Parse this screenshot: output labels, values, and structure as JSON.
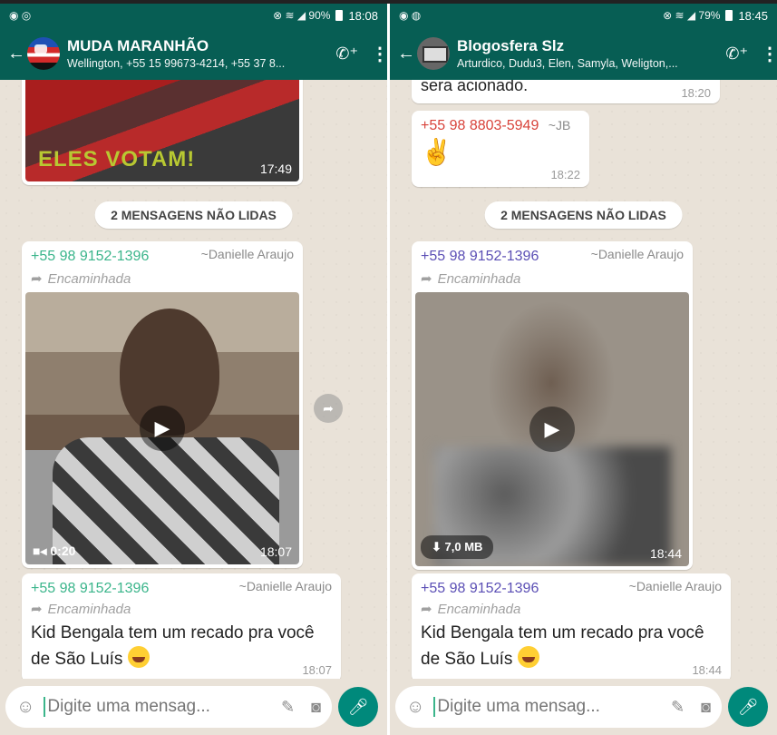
{
  "left": {
    "status": {
      "left_icons": "◉ ◎",
      "right_text": "⊗ ≋ ◢ 90%",
      "time": "18:08"
    },
    "header": {
      "title": "MUDA MARANHÃO",
      "subtitle": "Wellington, +55 15 99673-4214, +55 37 8..."
    },
    "top_image": {
      "overlay_text": "ELES VOTAM!",
      "time": "17:49"
    },
    "unread_banner": "2 MENSAGENS NÃO LIDAS",
    "video_msg": {
      "sender": "+55 98 9152-1396",
      "nick": "~Danielle Araujo",
      "forwarded": "Encaminhada",
      "duration": "0:20",
      "time": "18:07"
    },
    "text_msg": {
      "sender": "+55 98 9152-1396",
      "nick": "~Danielle Araujo",
      "forwarded": "Encaminhada",
      "text": "Kid Bengala tem um recado pra você de São Luís",
      "time": "18:07"
    },
    "input_placeholder": "Digite uma mensag..."
  },
  "right": {
    "status": {
      "left_icons": "◉ ◍",
      "right_text": "⊗ ≋ ◢ 79%",
      "time": "18:45"
    },
    "header": {
      "title": "Blogosfera Slz",
      "subtitle": "Arturdico, Dudu3, Elen, Samyla, Weligton,..."
    },
    "prev_msg": {
      "text": "sera acionado.",
      "time": "18:20"
    },
    "peace_msg": {
      "sender": "+55 98 8803-5949",
      "nick": "~JB",
      "emoji": "✌",
      "time": "18:22"
    },
    "unread_banner": "2 MENSAGENS NÃO LIDAS",
    "video_msg": {
      "sender": "+55 98 9152-1396",
      "nick": "~Danielle Araujo",
      "forwarded": "Encaminhada",
      "size": "7,0 MB",
      "time": "18:44"
    },
    "text_msg": {
      "sender": "+55 98 9152-1396",
      "nick": "~Danielle Araujo",
      "forwarded": "Encaminhada",
      "text": "Kid Bengala tem um recado pra você de São Luís",
      "time": "18:44"
    },
    "input_placeholder": "Digite uma mensag..."
  },
  "colors": {
    "header": "#075e54",
    "accent": "#00897b",
    "sender_green": "#3bb58b",
    "sender_purple": "#5b4fb5",
    "sender_red": "#d8433b"
  },
  "icons": [
    "back-arrow-icon",
    "add-call-icon",
    "more-menu-icon",
    "forward-arrow-icon",
    "play-icon",
    "video-camera-icon",
    "download-icon",
    "share-icon",
    "smiley-icon",
    "attach-icon",
    "camera-icon",
    "mic-icon"
  ]
}
